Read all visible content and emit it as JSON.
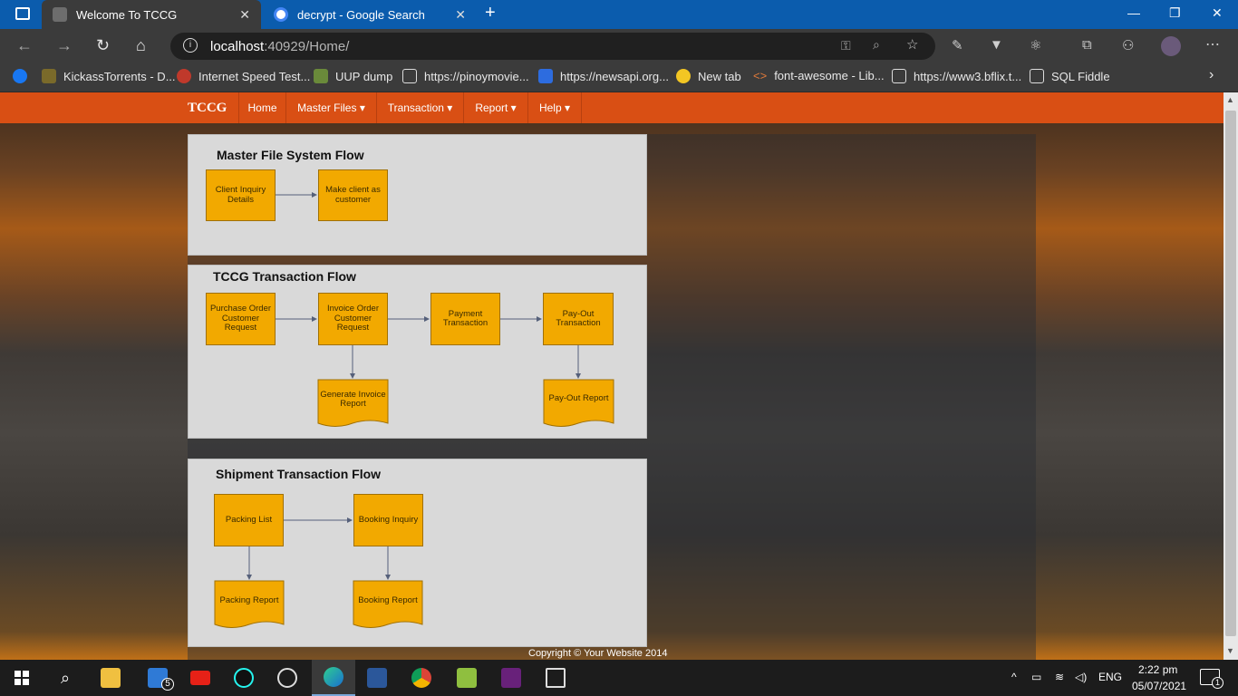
{
  "browser": {
    "tabs": [
      {
        "title": "Welcome To TCCG",
        "active": true
      },
      {
        "title": "decrypt - Google Search",
        "active": false
      }
    ],
    "new_tab": "+",
    "window_controls": {
      "minimize": "—",
      "maximize": "❐",
      "close": "✕"
    },
    "address": {
      "host": "localhost",
      "path": ":40929/Home/"
    },
    "bookmarks": [
      {
        "label": "KickassTorrents - D..."
      },
      {
        "label": "Internet Speed Test..."
      },
      {
        "label": "UUP dump"
      },
      {
        "label": "https://pinoymovie..."
      },
      {
        "label": "https://newsapi.org..."
      },
      {
        "label": "New tab"
      },
      {
        "label": "font-awesome - Lib..."
      },
      {
        "label": "https://www3.bflix.t..."
      },
      {
        "label": "SQL Fiddle"
      }
    ]
  },
  "site": {
    "brand": "TCCG",
    "nav": [
      {
        "label": "Home"
      },
      {
        "label": "Master Files ▾"
      },
      {
        "label": "Transaction ▾"
      },
      {
        "label": "Report ▾"
      },
      {
        "label": "Help ▾"
      }
    ],
    "accent": "#d94f14",
    "footer": "Copyright © Your Website 2014"
  },
  "flows": {
    "master": {
      "title": "Master File System Flow",
      "boxes": [
        "Client Inquiry Details",
        "Make client as customer"
      ]
    },
    "transaction": {
      "title": "TCCG Transaction Flow",
      "boxes": [
        "Purchase Order Customer Request",
        "Invoice Order Customer Request",
        "Payment Transaction",
        "Pay-Out Transaction"
      ],
      "docs": [
        "Generate Invoice Report",
        "Pay-Out Report"
      ]
    },
    "shipment": {
      "title": "Shipment Transaction Flow",
      "boxes": [
        "Packing List",
        "Booking Inquiry"
      ],
      "docs": [
        "Packing Report",
        "Booking Report"
      ]
    },
    "box_color": "#f2a900"
  },
  "taskbar": {
    "badge_count": "5",
    "lang": "ENG",
    "time": "2:22 pm",
    "date": "05/07/2021",
    "notifications": "1"
  }
}
